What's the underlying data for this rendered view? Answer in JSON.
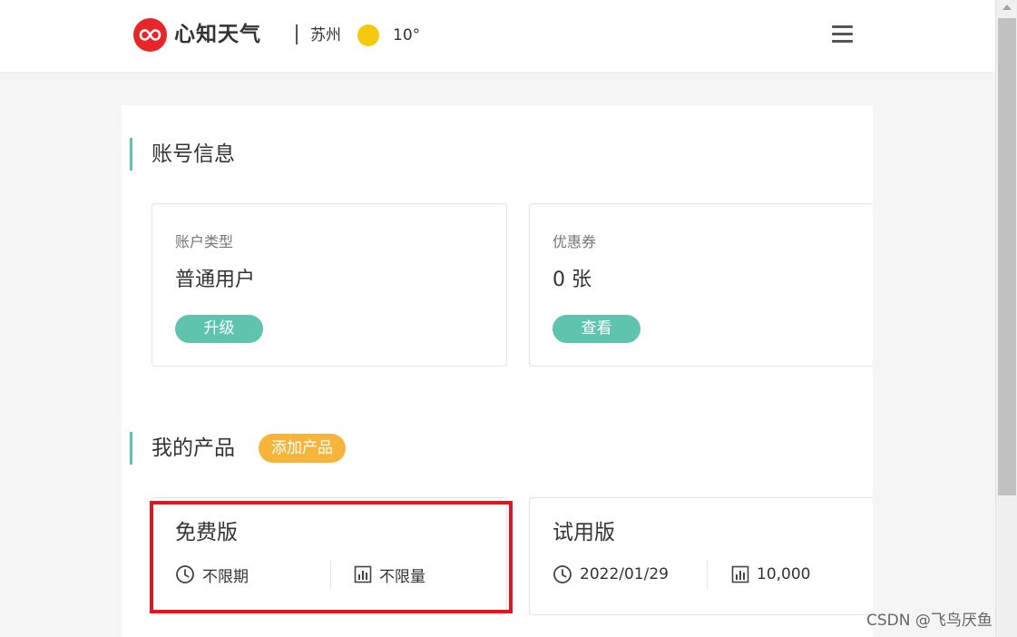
{
  "header": {
    "brand": "心知天气",
    "city": "苏州",
    "temperature": "10°"
  },
  "account_section": {
    "title": "账号信息",
    "cards": [
      {
        "label": "账户类型",
        "value": "普通用户",
        "button": "升级"
      },
      {
        "label": "优惠券",
        "value": "0 张",
        "button": "查看"
      }
    ]
  },
  "products_section": {
    "title": "我的产品",
    "add_button": "添加产品",
    "products": [
      {
        "name": "免费版",
        "period": "不限期",
        "quota": "不限量"
      },
      {
        "name": "试用版",
        "period": "2022/01/29",
        "quota": "10,000"
      }
    ]
  },
  "watermark": "CSDN @飞鸟厌鱼",
  "colors": {
    "accent_green": "#5ec4ae",
    "accent_orange": "#f6b53a",
    "brand_red": "#e8262a",
    "highlight_red": "#e3161d"
  }
}
